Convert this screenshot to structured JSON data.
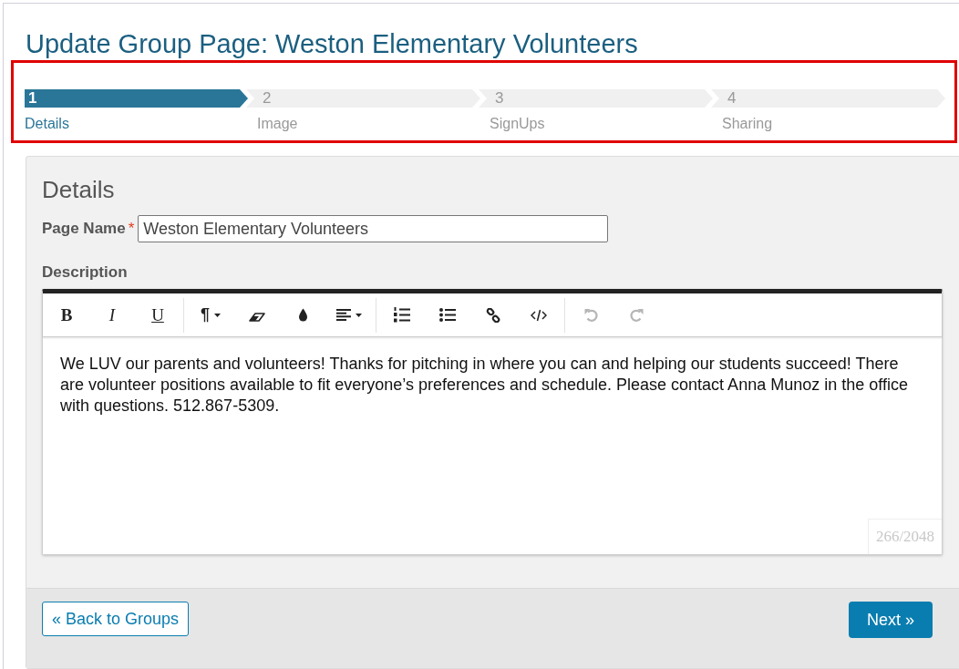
{
  "page": {
    "title": "Update Group Page: Weston Elementary Volunteers"
  },
  "stepper": {
    "highlighted": true,
    "steps": [
      {
        "number": "1",
        "label": "Details",
        "selected": true
      },
      {
        "number": "2",
        "label": "Image",
        "selected": false
      },
      {
        "number": "3",
        "label": "SignUps",
        "selected": false
      },
      {
        "number": "4",
        "label": "Sharing",
        "selected": false
      }
    ]
  },
  "details": {
    "heading": "Details",
    "page_name": {
      "label": "Page Name",
      "required_mark": "*",
      "value": "Weston Elementary Volunteers"
    },
    "description": {
      "label": "Description",
      "toolbar": [
        {
          "items": [
            {
              "kind": "bold",
              "glyph": "B",
              "dropdown": false,
              "disabled": false
            },
            {
              "kind": "italic",
              "glyph": "I",
              "dropdown": false,
              "disabled": false
            },
            {
              "kind": "underline",
              "glyph": "U",
              "dropdown": false,
              "disabled": false
            }
          ]
        },
        {
          "items": [
            {
              "kind": "paragraph",
              "glyph": "¶",
              "dropdown": true,
              "disabled": false
            },
            {
              "kind": "eraser",
              "dropdown": false,
              "disabled": false
            },
            {
              "kind": "color",
              "dropdown": false,
              "disabled": false
            },
            {
              "kind": "align",
              "dropdown": true,
              "disabled": false
            }
          ]
        },
        {
          "items": [
            {
              "kind": "ordered_list",
              "dropdown": false,
              "disabled": false
            },
            {
              "kind": "unordered_list",
              "dropdown": false,
              "disabled": false
            },
            {
              "kind": "link",
              "dropdown": false,
              "disabled": false
            },
            {
              "kind": "code",
              "dropdown": false,
              "disabled": false
            }
          ]
        },
        {
          "items": [
            {
              "kind": "undo",
              "dropdown": false,
              "disabled": true
            },
            {
              "kind": "redo",
              "dropdown": false,
              "disabled": true
            }
          ]
        }
      ],
      "text": "We LUV our parents and volunteers! Thanks for pitching in where you can and helping our students succeed! There are volunteer positions available to fit everyone’s preferences and schedule. Please contact Anna Munoz in the office with questions. 512.867-5309.",
      "counter": "266/2048"
    }
  },
  "footer": {
    "back_button": "« Back to Groups",
    "next_button": "Next »"
  }
}
